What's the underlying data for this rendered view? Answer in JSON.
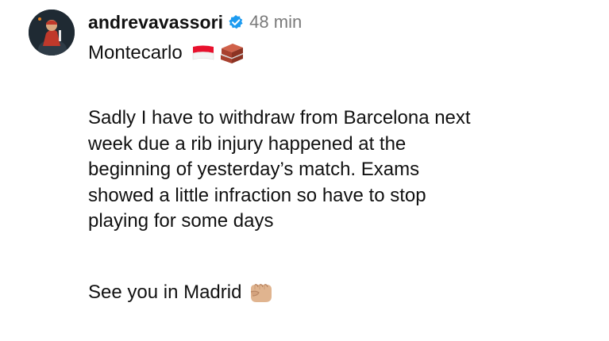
{
  "post": {
    "username": "andrevavassori",
    "timestamp": "48 min",
    "location": "Montecarlo",
    "body_lines": [
      "Sadly I have to withdraw from Barcelona next",
      "week due a rib injury happened at the",
      "beginning of yesterday’s match. Exams",
      "showed a little infraction so have to stop",
      "playing for some days"
    ],
    "signoff": "See you in Madrid"
  },
  "icons": {
    "avatar": "profile-photo",
    "verified": "verified-badge-icon",
    "flag": "monaco-flag-icon",
    "bricks": "brick-icon",
    "fist": "fist-bump-icon"
  },
  "colors": {
    "verified": "#1d9bf0",
    "timestamp": "#7a7a7a",
    "text": "#111111"
  }
}
